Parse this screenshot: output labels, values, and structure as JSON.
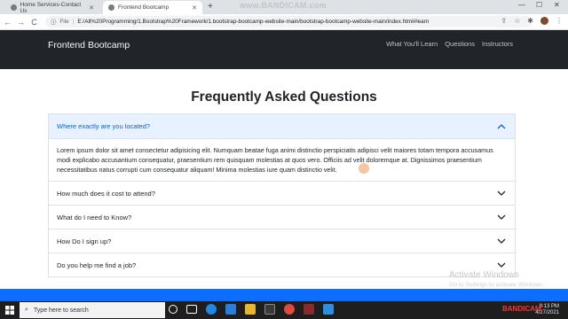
{
  "browser": {
    "tabs": [
      {
        "label": "Home Services-Contact Us"
      },
      {
        "label": "Frontend Bootcamp"
      }
    ],
    "new_tab": "+",
    "watermark": "www.BANDICAM.com",
    "nav": {
      "back": "←",
      "forward": "→",
      "reload": "C"
    },
    "address": {
      "scheme_label": "File",
      "url": "E:/All%20Programming/1.Bootstrap%20Framework/1.bootstrap-bootcamp-website-main/bootstrap-bootcamp-website-main/index.html#learn"
    }
  },
  "navbar": {
    "brand": "Frontend Bootcamp",
    "links": [
      "What You'll Learn",
      "Questions",
      "Instructors"
    ]
  },
  "faq": {
    "title": "Frequently Asked Questions",
    "items": [
      {
        "question": "Where exactly are you located?",
        "expanded": true,
        "answer": "Lorem ipsum dolor sit amet consectetur adipisicing elit. Numquam beatae fuga animi distinctio perspiciatis adipisci velit maiores totam tempora accusamus modi explicabo accusantium consequatur, praesentium rem quisquam molestias at quos vero. Officiis ad velit doloremque at. Dignissimos praesentium necessitatibus natus corrupti cum consequatur aliquam! Minima molestias iure quam distinctio velit."
      },
      {
        "question": "How much does it cost to attend?",
        "expanded": false
      },
      {
        "question": "What do I need to Know?",
        "expanded": false
      },
      {
        "question": "How Do I sign up?",
        "expanded": false
      },
      {
        "question": "Do you help me find a job?",
        "expanded": false
      }
    ]
  },
  "windows": {
    "activate_title": "Activate Windows",
    "activate_sub": "Go to Settings to activate Windows.",
    "search_placeholder": "Type here to search",
    "time": "9:13 PM",
    "date": "4/27/2021",
    "recorder": "BANDICAM"
  },
  "colors": {
    "navbar": "#212529",
    "accordion_open_bg": "#e7f1ff",
    "accordion_open_text": "#0c63e4",
    "primary": "#0d6efd"
  }
}
